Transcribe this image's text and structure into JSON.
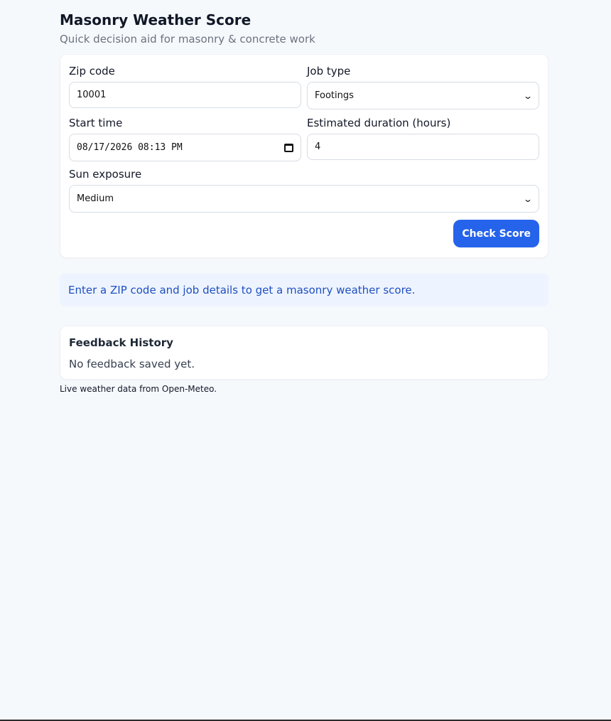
{
  "header": {
    "title": "Masonry Weather Score",
    "subtitle": "Quick decision aid for masonry & concrete work"
  },
  "form": {
    "zip": {
      "label": "Zip code",
      "value": "10001"
    },
    "job_type": {
      "label": "Job type",
      "selected": "Footings"
    },
    "start_time": {
      "label": "Start time",
      "value": "08/17/2026 08:13 PM"
    },
    "duration": {
      "label": "Estimated duration (hours)",
      "value": "4"
    },
    "sun_exposure": {
      "label": "Sun exposure",
      "selected": "Medium"
    },
    "submit_label": "Check Score"
  },
  "notice": {
    "text": "Enter a ZIP code and job details to get a masonry weather score."
  },
  "history": {
    "title": "Feedback History",
    "empty_text": "No feedback saved yet."
  },
  "footer": {
    "note": "Live weather data from Open-Meteo."
  },
  "icons": {
    "calendar": "calendar-icon",
    "dropdown": "chevron-down-icon"
  },
  "colors": {
    "accent": "#2563eb",
    "notice_bg": "#eef4ff",
    "notice_text": "#1e4fbf",
    "page_bg": "#f6f9fc"
  }
}
